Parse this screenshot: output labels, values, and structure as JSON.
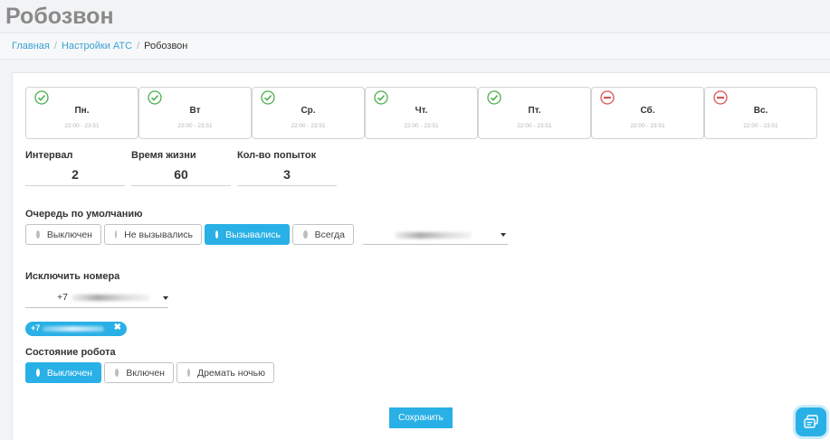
{
  "page": {
    "title": "Робозвон"
  },
  "breadcrumb": {
    "home": "Главная",
    "settings": "Настройки АТС",
    "current": "Робозвон"
  },
  "days": [
    {
      "name": "Пн.",
      "time": "22:00 - 23:51",
      "enabled": true
    },
    {
      "name": "Вт",
      "time": "22:00 - 23:51",
      "enabled": true
    },
    {
      "name": "Ср.",
      "time": "22:00 - 23:51",
      "enabled": true
    },
    {
      "name": "Чт.",
      "time": "22:00 - 23:51",
      "enabled": true
    },
    {
      "name": "Пт.",
      "time": "22:00 - 23:51",
      "enabled": true
    },
    {
      "name": "Сб.",
      "time": "22:00 - 23:51",
      "enabled": false
    },
    {
      "name": "Вс.",
      "time": "22:00 - 23:51",
      "enabled": false
    }
  ],
  "fields": {
    "interval": {
      "label": "Интервал",
      "value": "2"
    },
    "lifetime": {
      "label": "Время жизни",
      "value": "60"
    },
    "attempts": {
      "label": "Кол-во попыток",
      "value": "3"
    }
  },
  "queue": {
    "label": "Очередь по умолчанию",
    "options": [
      "Выключен",
      "Не вызывались",
      "Вызывались",
      "Всегда"
    ],
    "selected": "Вызывались"
  },
  "exclude": {
    "label": "Исключить номера",
    "prefix": "+7",
    "tag_prefix": "+7"
  },
  "robot_state": {
    "label": "Состояние робота",
    "options": [
      "Выключен",
      "Включен",
      "Дремать ночью"
    ],
    "selected": "Выключен"
  },
  "actions": {
    "save": "Сохранить"
  },
  "colors": {
    "accent": "#29b0e6",
    "enabled": "#4cae4c",
    "disabled": "#d9534f"
  }
}
